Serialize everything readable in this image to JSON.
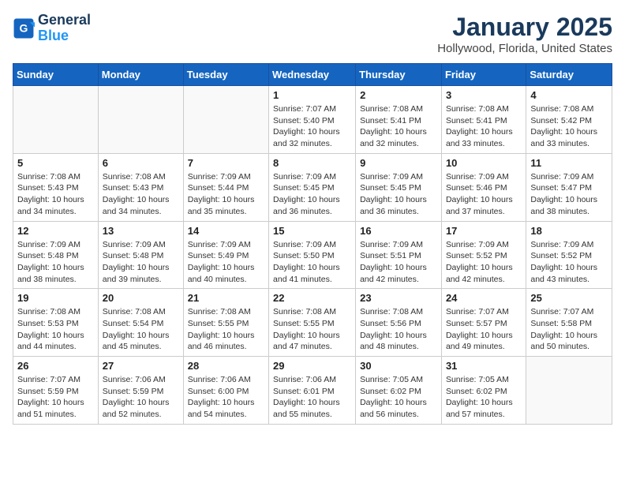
{
  "header": {
    "logo_line1": "General",
    "logo_line2": "Blue",
    "title": "January 2025",
    "subtitle": "Hollywood, Florida, United States"
  },
  "columns": [
    "Sunday",
    "Monday",
    "Tuesday",
    "Wednesday",
    "Thursday",
    "Friday",
    "Saturday"
  ],
  "weeks": [
    [
      {
        "day": "",
        "info": ""
      },
      {
        "day": "",
        "info": ""
      },
      {
        "day": "",
        "info": ""
      },
      {
        "day": "1",
        "info": "Sunrise: 7:07 AM\nSunset: 5:40 PM\nDaylight: 10 hours\nand 32 minutes."
      },
      {
        "day": "2",
        "info": "Sunrise: 7:08 AM\nSunset: 5:41 PM\nDaylight: 10 hours\nand 32 minutes."
      },
      {
        "day": "3",
        "info": "Sunrise: 7:08 AM\nSunset: 5:41 PM\nDaylight: 10 hours\nand 33 minutes."
      },
      {
        "day": "4",
        "info": "Sunrise: 7:08 AM\nSunset: 5:42 PM\nDaylight: 10 hours\nand 33 minutes."
      }
    ],
    [
      {
        "day": "5",
        "info": "Sunrise: 7:08 AM\nSunset: 5:43 PM\nDaylight: 10 hours\nand 34 minutes."
      },
      {
        "day": "6",
        "info": "Sunrise: 7:08 AM\nSunset: 5:43 PM\nDaylight: 10 hours\nand 34 minutes."
      },
      {
        "day": "7",
        "info": "Sunrise: 7:09 AM\nSunset: 5:44 PM\nDaylight: 10 hours\nand 35 minutes."
      },
      {
        "day": "8",
        "info": "Sunrise: 7:09 AM\nSunset: 5:45 PM\nDaylight: 10 hours\nand 36 minutes."
      },
      {
        "day": "9",
        "info": "Sunrise: 7:09 AM\nSunset: 5:45 PM\nDaylight: 10 hours\nand 36 minutes."
      },
      {
        "day": "10",
        "info": "Sunrise: 7:09 AM\nSunset: 5:46 PM\nDaylight: 10 hours\nand 37 minutes."
      },
      {
        "day": "11",
        "info": "Sunrise: 7:09 AM\nSunset: 5:47 PM\nDaylight: 10 hours\nand 38 minutes."
      }
    ],
    [
      {
        "day": "12",
        "info": "Sunrise: 7:09 AM\nSunset: 5:48 PM\nDaylight: 10 hours\nand 38 minutes."
      },
      {
        "day": "13",
        "info": "Sunrise: 7:09 AM\nSunset: 5:48 PM\nDaylight: 10 hours\nand 39 minutes."
      },
      {
        "day": "14",
        "info": "Sunrise: 7:09 AM\nSunset: 5:49 PM\nDaylight: 10 hours\nand 40 minutes."
      },
      {
        "day": "15",
        "info": "Sunrise: 7:09 AM\nSunset: 5:50 PM\nDaylight: 10 hours\nand 41 minutes."
      },
      {
        "day": "16",
        "info": "Sunrise: 7:09 AM\nSunset: 5:51 PM\nDaylight: 10 hours\nand 42 minutes."
      },
      {
        "day": "17",
        "info": "Sunrise: 7:09 AM\nSunset: 5:52 PM\nDaylight: 10 hours\nand 42 minutes."
      },
      {
        "day": "18",
        "info": "Sunrise: 7:09 AM\nSunset: 5:52 PM\nDaylight: 10 hours\nand 43 minutes."
      }
    ],
    [
      {
        "day": "19",
        "info": "Sunrise: 7:08 AM\nSunset: 5:53 PM\nDaylight: 10 hours\nand 44 minutes."
      },
      {
        "day": "20",
        "info": "Sunrise: 7:08 AM\nSunset: 5:54 PM\nDaylight: 10 hours\nand 45 minutes."
      },
      {
        "day": "21",
        "info": "Sunrise: 7:08 AM\nSunset: 5:55 PM\nDaylight: 10 hours\nand 46 minutes."
      },
      {
        "day": "22",
        "info": "Sunrise: 7:08 AM\nSunset: 5:55 PM\nDaylight: 10 hours\nand 47 minutes."
      },
      {
        "day": "23",
        "info": "Sunrise: 7:08 AM\nSunset: 5:56 PM\nDaylight: 10 hours\nand 48 minutes."
      },
      {
        "day": "24",
        "info": "Sunrise: 7:07 AM\nSunset: 5:57 PM\nDaylight: 10 hours\nand 49 minutes."
      },
      {
        "day": "25",
        "info": "Sunrise: 7:07 AM\nSunset: 5:58 PM\nDaylight: 10 hours\nand 50 minutes."
      }
    ],
    [
      {
        "day": "26",
        "info": "Sunrise: 7:07 AM\nSunset: 5:59 PM\nDaylight: 10 hours\nand 51 minutes."
      },
      {
        "day": "27",
        "info": "Sunrise: 7:06 AM\nSunset: 5:59 PM\nDaylight: 10 hours\nand 52 minutes."
      },
      {
        "day": "28",
        "info": "Sunrise: 7:06 AM\nSunset: 6:00 PM\nDaylight: 10 hours\nand 54 minutes."
      },
      {
        "day": "29",
        "info": "Sunrise: 7:06 AM\nSunset: 6:01 PM\nDaylight: 10 hours\nand 55 minutes."
      },
      {
        "day": "30",
        "info": "Sunrise: 7:05 AM\nSunset: 6:02 PM\nDaylight: 10 hours\nand 56 minutes."
      },
      {
        "day": "31",
        "info": "Sunrise: 7:05 AM\nSunset: 6:02 PM\nDaylight: 10 hours\nand 57 minutes."
      },
      {
        "day": "",
        "info": ""
      }
    ]
  ]
}
